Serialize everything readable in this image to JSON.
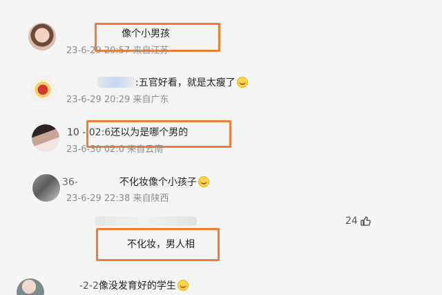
{
  "comments": [
    {
      "text": "像个小男孩",
      "meta": "23-6-29 20:57 来自江苏"
    },
    {
      "text": ":五官好看，就是太瘦了",
      "meta": "23-6-29 20:29 来自广东"
    },
    {
      "text": "还以为是哪个男的",
      "prefix": "10 - 02:6",
      "meta": "23-6-30 02:0 来自云南"
    },
    {
      "text": "不化妆像个小孩子",
      "prefix": "36-",
      "meta": "23-6-29 22:38 来自陕西"
    }
  ],
  "reply": {
    "text": "不化妆，男人相",
    "likes": "24"
  },
  "last_comment": {
    "prefix": "-2-2",
    "text": "像没发育好的学生"
  },
  "colors": {
    "highlight_box": "#ef7d35",
    "meta_text": "#8c8c8c"
  },
  "icons": {
    "emoji": "laugh-cry-emoji",
    "like": "thumbs-up-icon"
  }
}
